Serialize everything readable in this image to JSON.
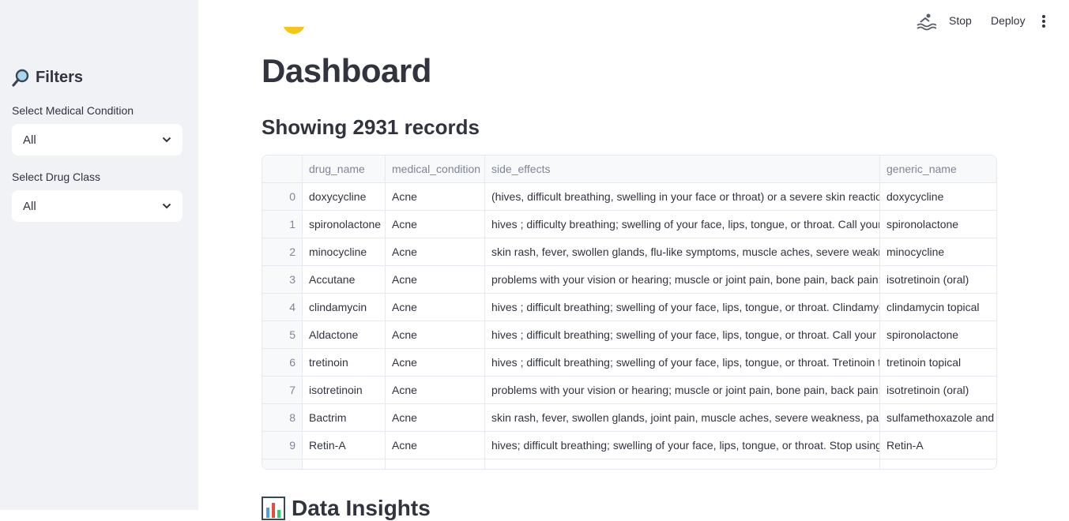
{
  "sidebar": {
    "header": "Filters",
    "header_icon": "magnifier-icon",
    "condition_label": "Select Medical Condition",
    "condition_value": "All",
    "class_label": "Select Drug Class",
    "class_value": "All"
  },
  "toolbar": {
    "stop_label": "Stop",
    "deploy_label": "Deploy"
  },
  "main": {
    "title": "Dashboard",
    "records_heading": "Showing 2931 records",
    "insights_heading": "Data Insights"
  },
  "table": {
    "columns": [
      "",
      "drug_name",
      "medical_condition",
      "side_effects",
      "generic_name"
    ],
    "rows": [
      [
        "0",
        "doxycycline",
        "Acne",
        "(hives, difficult breathing, swelling in your face or throat) or a severe skin reaction (fev",
        "doxycycline"
      ],
      [
        "1",
        "spironolactone",
        "Acne",
        "hives ; difficulty breathing; swelling of your face, lips, tongue, or throat. Call your doct",
        "spironolactone"
      ],
      [
        "2",
        "minocycline",
        "Acne",
        "skin rash, fever, swollen glands, flu-like symptoms, muscle aches, severe weakness, u",
        "minocycline"
      ],
      [
        "3",
        "Accutane",
        "Acne",
        "problems with your vision or hearing; muscle or joint pain, bone pain, back pain; incr",
        "isotretinoin (oral)"
      ],
      [
        "4",
        "clindamycin",
        "Acne",
        "hives ; difficult breathing; swelling of your face, lips, tongue, or throat. Clindamycin to",
        "clindamycin topical"
      ],
      [
        "5",
        "Aldactone",
        "Acne",
        "hives ; difficult breathing; swelling of your face, lips, tongue, or throat. Call your doct",
        "spironolactone"
      ],
      [
        "6",
        "tretinoin",
        "Acne",
        "hives ; difficult breathing; swelling of your face, lips, tongue, or throat. Tretinoin topic",
        "tretinoin topical"
      ],
      [
        "7",
        "isotretinoin",
        "Acne",
        "problems with your vision or hearing; muscle or joint pain, bone pain, back pain; incr",
        "isotretinoin (oral)"
      ],
      [
        "8",
        "Bactrim",
        "Acne",
        "skin rash, fever, swollen glands, joint pain, muscle aches, severe weakness, pale skin,",
        "sulfamethoxazole and t"
      ],
      [
        "9",
        "Retin-A",
        "Acne",
        "hives; difficult breathing; swelling of your face, lips, tongue, or throat. Stop using Reti",
        "Retin-A"
      ]
    ]
  },
  "colors": {
    "sidebar_bg": "#f0f2f6",
    "text": "#31333f",
    "muted": "#808495",
    "border": "#e6e9ef"
  }
}
